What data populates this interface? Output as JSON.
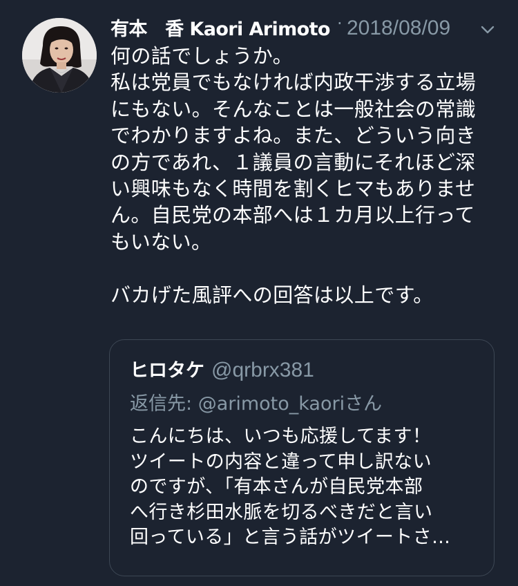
{
  "tweet": {
    "author_name": "有本　香  Kaori Arimoto",
    "separator": "·",
    "date": "2018/08/09",
    "menu_icon": "chevron-down-icon",
    "avatar_icon": "profile-photo",
    "text": "何の話でしょうか。\n私は党員でもなければ内政干渉する立場\nにもない。そんなことは一般社会の常識\nでわかりますよね。また、どういう向き\nの方であれ、１議員の言動にそれほど深\nい興味もなく時間を割くヒマもありませ\nん。自民党の本部へは１カ月以上行って\nもいない。\n\nバカげた風評への回答は以上です。"
  },
  "quoted_tweet": {
    "author_name": "ヒロタケ",
    "handle": "@qrbrx381",
    "reply_prefix": "返信先: ",
    "reply_mention": "@arimoto_kaori",
    "reply_suffix": "さん",
    "text": "こんにちは、いつも応援してます！\nツイートの内容と違って申し訳ない\nのですが、「有本さんが自民党本部\nへ行き杉田水脈を切るべきだと言い\n回っている」と言う話がツイートさ…"
  },
  "colors": {
    "background": "#1c2330",
    "text": "#ffffff",
    "secondary_text": "#8899a6",
    "quote_border": "#3d4754"
  }
}
